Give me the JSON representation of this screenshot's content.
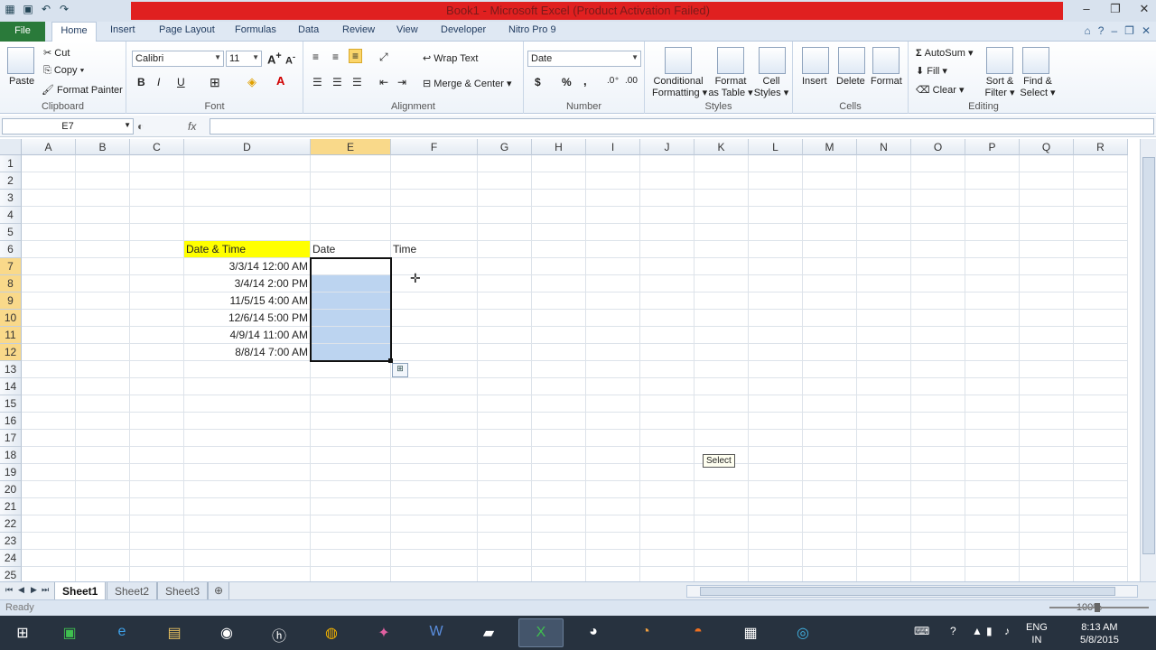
{
  "window": {
    "title": "Book1 - Microsoft Excel (Product Activation Failed)"
  },
  "ribbon_tabs": [
    "File",
    "Home",
    "Insert",
    "Page Layout",
    "Formulas",
    "Data",
    "Review",
    "View",
    "Developer",
    "Nitro Pro 9"
  ],
  "clipboard": {
    "paste": "Paste",
    "cut": "Cut",
    "copy": "Copy",
    "format_painter": "Format Painter",
    "label": "Clipboard"
  },
  "font": {
    "name": "Calibri",
    "size": "11",
    "bold": "B",
    "italic": "I",
    "underline": "U",
    "label": "Font"
  },
  "alignment": {
    "wrap_text": "Wrap Text",
    "merge_center": "Merge & Center",
    "label": "Alignment"
  },
  "number": {
    "format": "Date",
    "currency": "$",
    "percent": "%",
    "comma": ",",
    "label": "Number"
  },
  "styles": {
    "conditional_formatting_1": "Conditional",
    "conditional_formatting_2": "Formatting",
    "format_as_table_1": "Format",
    "format_as_table_2": "as Table",
    "cell_styles_1": "Cell",
    "cell_styles_2": "Styles",
    "label": "Styles"
  },
  "cells": {
    "insert": "Insert",
    "delete": "Delete",
    "format": "Format",
    "label": "Cells"
  },
  "editing": {
    "autosum": "AutoSum",
    "fill": "Fill",
    "clear": "Clear",
    "sort_filter_1": "Sort &",
    "sort_filter_2": "Filter",
    "find_select_1": "Find &",
    "find_select_2": "Select",
    "label": "Editing"
  },
  "formula_bar": {
    "name_box": "E7",
    "fx": "fx",
    "content": ""
  },
  "columns": [
    "A",
    "B",
    "C",
    "D",
    "E",
    "F",
    "G",
    "H",
    "I",
    "J",
    "K",
    "L",
    "M",
    "N",
    "O",
    "P",
    "Q",
    "R"
  ],
  "rows": [
    "1",
    "2",
    "3",
    "4",
    "5",
    "6",
    "7",
    "8",
    "9",
    "10",
    "11",
    "12",
    "13",
    "14",
    "15",
    "16",
    "17",
    "18",
    "19",
    "20",
    "21",
    "22",
    "23",
    "24",
    "25"
  ],
  "sheet": {
    "D6": "Date & Time",
    "E6": "Date",
    "F6": "Time",
    "D7": "3/3/14 12:00 AM",
    "D8": "3/4/14 2:00 PM",
    "D9": "11/5/15 4:00 AM",
    "D10": "12/6/14 5:00 PM",
    "D11": "4/9/14 11:00 AM",
    "D12": "8/8/14 7:00 AM"
  },
  "tooltip": "Select",
  "sheet_tabs": [
    "Sheet1",
    "Sheet2",
    "Sheet3"
  ],
  "status": {
    "text": "Ready",
    "zoom": "100%"
  },
  "tray": {
    "lang_1": "ENG",
    "lang_2": "IN",
    "time": "8:13 AM",
    "date": "5/8/2015"
  },
  "colors": {
    "header_fill": "#ffff00",
    "selection_fill": "#bcd4f0",
    "file_tab": "#2a7a3a",
    "title_band": "#e02020"
  }
}
